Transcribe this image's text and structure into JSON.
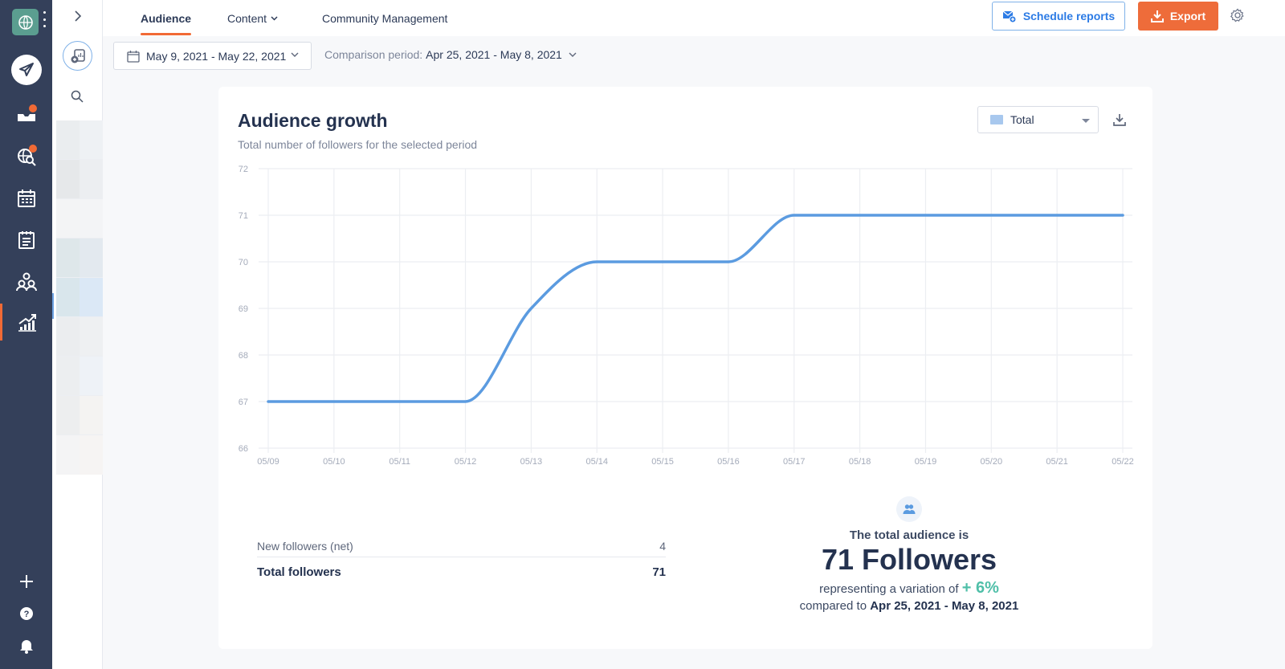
{
  "rail": {
    "items": [
      {
        "name": "publish",
        "icon": "paper-plane-icon"
      },
      {
        "name": "inbox",
        "icon": "inbox-tray-icon",
        "badge": true
      },
      {
        "name": "listening",
        "icon": "globe-search-icon",
        "badge": true
      },
      {
        "name": "calendar",
        "icon": "calendar-icon"
      },
      {
        "name": "notes",
        "icon": "notepad-icon"
      },
      {
        "name": "team",
        "icon": "users-group-icon"
      },
      {
        "name": "analytics",
        "icon": "analytics-chart-icon",
        "active": true
      }
    ],
    "bottom": [
      {
        "name": "add",
        "icon": "plus-icon"
      },
      {
        "name": "help",
        "icon": "question-icon"
      },
      {
        "name": "notifications",
        "icon": "bell-icon"
      }
    ]
  },
  "nav": {
    "tabs": [
      {
        "label": "Audience",
        "active": true
      },
      {
        "label": "Content",
        "dropdown": true
      },
      {
        "label": "Community Management"
      }
    ],
    "schedule_label": "Schedule reports",
    "export_label": "Export"
  },
  "filters": {
    "date_range": "May 9, 2021 - May 22, 2021",
    "comparison_label": "Comparison period:",
    "comparison_value": "Apr 25, 2021 - May 8, 2021"
  },
  "card": {
    "title": "Audience growth",
    "subtitle": "Total number of followers for the selected period",
    "view_select": "Total"
  },
  "chart_data": {
    "type": "line",
    "title": "Audience growth",
    "xlabel": "",
    "ylabel": "",
    "x": [
      "05/09",
      "05/10",
      "05/11",
      "05/12",
      "05/13",
      "05/14",
      "05/15",
      "05/16",
      "05/17",
      "05/18",
      "05/19",
      "05/20",
      "05/21",
      "05/22"
    ],
    "series": [
      {
        "name": "Total",
        "color": "#5b9be0",
        "values": [
          67,
          67,
          67,
          67,
          69,
          70,
          70,
          70,
          71,
          71,
          71,
          71,
          71,
          71
        ]
      }
    ],
    "yticks": [
      66,
      67,
      68,
      69,
      70,
      71,
      72
    ],
    "ylim": [
      66,
      72
    ],
    "grid": true,
    "legend": "none"
  },
  "stats": {
    "rows": [
      {
        "label": "New followers (net)",
        "value": "4"
      },
      {
        "label": "Total followers",
        "value": "71"
      }
    ]
  },
  "summary": {
    "line1": "The total audience is",
    "big": "71 Followers",
    "variation_prefix": "representing a variation of",
    "variation": "+ 6%",
    "compared_prefix": "compared to",
    "compared_range": "Apr 25, 2021 - May 8, 2021"
  },
  "colors": {
    "accent": "#f16a35",
    "primary_blue": "#2c7be5",
    "line": "#5b9be0",
    "positive": "#4fbfa8",
    "rail": "#34405a"
  }
}
